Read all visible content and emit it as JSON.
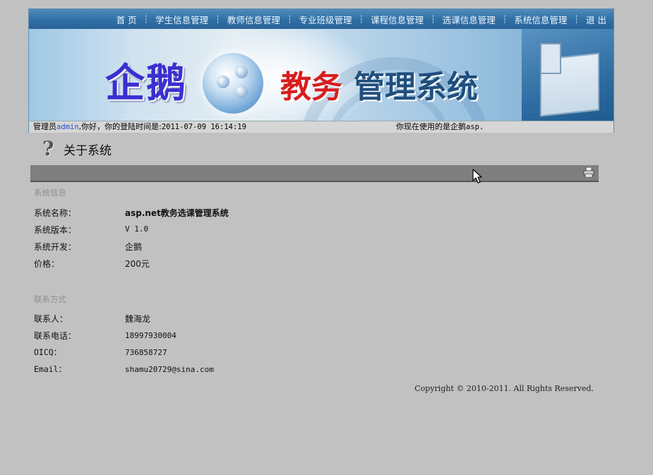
{
  "nav": {
    "items": [
      "首 页",
      "学生信息管理",
      "教师信息管理",
      "专业班级管理",
      "课程信息管理",
      "选课信息管理",
      "系统信息管理",
      "退 出"
    ]
  },
  "banner": {
    "logo_left": "企鹅",
    "logo_right_red": "教务",
    "logo_right_blue": "管理系统"
  },
  "status": {
    "prefix": "管理员",
    "user": "admin",
    "greeting": ",你好，你的登陆时间是:",
    "login_time": "2011-07-09 16:14:19",
    "right_text": "你现在使用的是企鹅",
    "right_suffix": "asp."
  },
  "page": {
    "title": "关于系统",
    "icon": "question-mark-icon"
  },
  "system_info": {
    "section_title": "系统信息",
    "rows": [
      {
        "label": "系统名称：",
        "value": "asp.net教务选课管理系统"
      },
      {
        "label": "系统版本：",
        "value": "V 1.0"
      },
      {
        "label": "系统开发：",
        "value": "企鹅"
      },
      {
        "label": "价格：",
        "value": "200元"
      }
    ]
  },
  "contact": {
    "section_title": "联系方式",
    "rows": [
      {
        "label": "联系人：",
        "value": "魏海龙"
      },
      {
        "label": "联系电话：",
        "value": "18997930004"
      },
      {
        "label": "OICQ：",
        "value": "736858727"
      },
      {
        "label": "Email：",
        "value": "shamu20729@sina.com"
      }
    ]
  },
  "footer": {
    "copyright": "Copyright © 2010-2011. All Rights Reserved."
  },
  "colors": {
    "page_bg": "#c1c1c1",
    "nav_bg": "#2f6ea4",
    "toolbar_bg": "#7f7f7f",
    "logo_blue": "#3a2fd0",
    "logo_red": "#d81e1e"
  }
}
